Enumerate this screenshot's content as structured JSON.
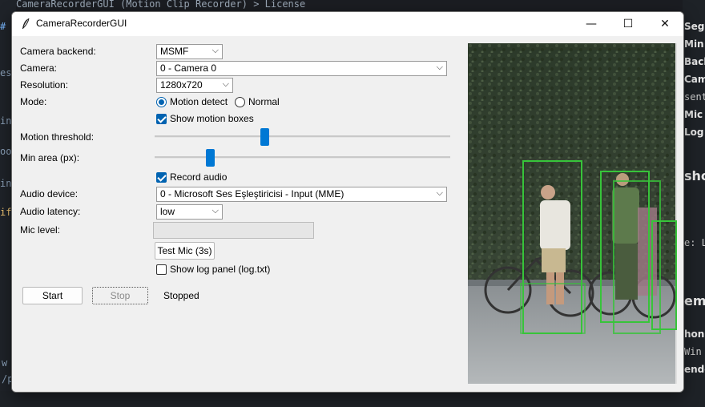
{
  "window": {
    "title": "CameraRecorderGUI",
    "controls": {
      "minimize": "—",
      "maximize": "☐",
      "close": "✕"
    }
  },
  "form": {
    "backend": {
      "label": "Camera backend:",
      "value": "MSMF"
    },
    "camera": {
      "label": "Camera:",
      "value": "0 - Camera 0"
    },
    "resolution": {
      "label": "Resolution:",
      "value": "1280x720"
    },
    "mode": {
      "label": "Mode:",
      "options": [
        {
          "label": "Motion detect",
          "selected": true
        },
        {
          "label": "Normal",
          "selected": false
        }
      ]
    },
    "show_boxes": {
      "label": "Show motion boxes",
      "checked": true
    },
    "motion_threshold": {
      "label": "Motion threshold:",
      "level": 0.37
    },
    "min_area": {
      "label": "Min area (px):",
      "level": 0.18
    },
    "record_audio": {
      "label": "Record audio",
      "checked": true
    },
    "audio_device": {
      "label": "Audio device:",
      "value": "0 - Microsoft Ses Eşleştiricisi - Input (MME)"
    },
    "audio_latency": {
      "label": "Audio latency:",
      "value": "low"
    },
    "mic_level": {
      "label": "Mic level:",
      "level": 0
    },
    "test_mic": {
      "label": "Test Mic (3s)"
    },
    "show_log": {
      "label": "Show log panel (log.txt)",
      "checked": false
    }
  },
  "actions": {
    "start": "Start",
    "stop": "Stop",
    "status": "Stopped"
  },
  "colors": {
    "accent": "#0078d4",
    "box_outline": "#37c43a"
  },
  "background_editor": {
    "left_fragments": [
      "Camera",
      "# b",
      "ese",
      "ina",
      "oot",
      "ind",
      "iff",
      "w",
      "/p"
    ],
    "right_fragments": [
      "Segr",
      "Min",
      "Back",
      "Cam",
      "sent",
      "Mic",
      "Log",
      "sho",
      "e: Liv",
      "em",
      "hon",
      "Win",
      "ende"
    ],
    "top_fragment": "CameraRecorderGUI (Motion Clip Recorder)  >  License"
  }
}
